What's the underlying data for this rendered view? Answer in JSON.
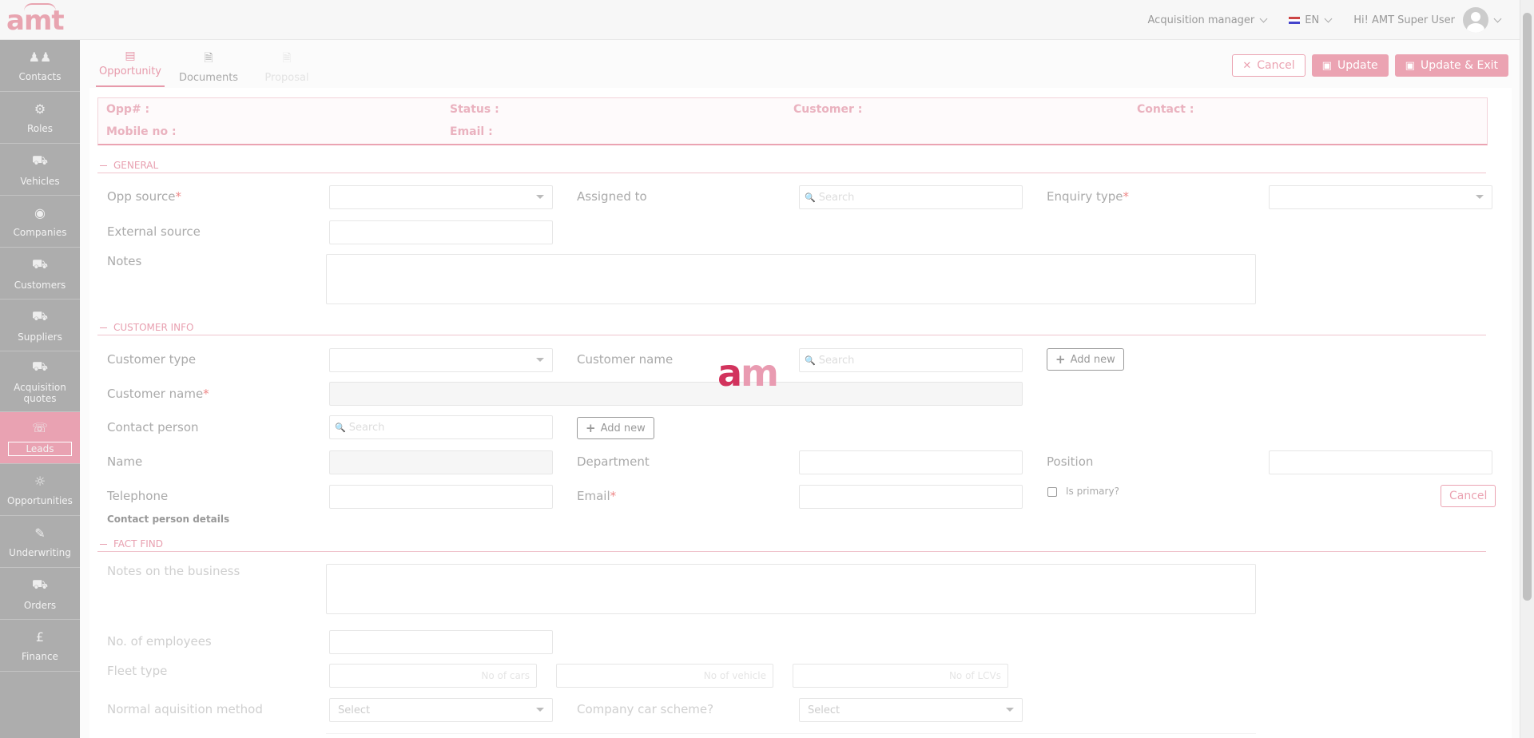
{
  "app": {
    "logo_text": "amt",
    "role_label": "Acquisition manager",
    "lang_label": "EN",
    "user_greeting": "Hi! AMT Super User"
  },
  "sidebar": {
    "items": [
      {
        "label": "Contacts",
        "icon": "contacts-icon"
      },
      {
        "label": "Roles",
        "icon": "roles-icon"
      },
      {
        "label": "Vehicles",
        "icon": "car-icon"
      },
      {
        "label": "Companies",
        "icon": "companies-icon"
      },
      {
        "label": "Customers",
        "icon": "customers-icon"
      },
      {
        "label": "Suppliers",
        "icon": "suppliers-icon"
      },
      {
        "label": "Acquisition quotes",
        "icon": "quotes-icon"
      },
      {
        "label": "Leads",
        "icon": "leads-icon",
        "active": true
      },
      {
        "label": "Opportunities",
        "icon": "bulb-icon"
      },
      {
        "label": "Underwriting",
        "icon": "underwriting-icon"
      },
      {
        "label": "Orders",
        "icon": "cart-icon"
      },
      {
        "label": "Finance",
        "icon": "pound-icon"
      }
    ]
  },
  "tabs": [
    {
      "label": "Opportunity",
      "state": "active"
    },
    {
      "label": "Documents",
      "state": "normal"
    },
    {
      "label": "Proposal",
      "state": "disabled"
    }
  ],
  "actions": {
    "cancel": "Cancel",
    "update": "Update",
    "update_exit": "Update & Exit"
  },
  "summary": {
    "opp": "Opp# :",
    "status": "Status :",
    "customer": "Customer :",
    "contact": "Contact :",
    "mobile": "Mobile no :",
    "email": "Email :"
  },
  "sections": {
    "general": "GENERAL",
    "customer_info": "CUSTOMER INFO",
    "fact_find": "FACT FIND"
  },
  "general": {
    "opp_source": "Opp source",
    "assigned_to": "Assigned to",
    "enquiry_type": "Enquiry type",
    "external_source": "External source",
    "notes": "Notes",
    "search_placeholder": "Search"
  },
  "customer_info": {
    "customer_type": "Customer type",
    "customer_name_search": "Customer name",
    "customer_name": "Customer name",
    "contact_person": "Contact person",
    "name": "Name",
    "department": "Department",
    "position": "Position",
    "telephone": "Telephone",
    "email": "Email",
    "is_primary": "Is primary?",
    "cancel": "Cancel",
    "contact_person_details": "Contact person details",
    "add_new": "Add new",
    "search_placeholder": "Search"
  },
  "fact_find": {
    "notes_business": "Notes on the business",
    "no_employees": "No. of employees",
    "fleet_type": "Fleet type",
    "no_of_cars": "No of cars",
    "no_of_vehicles": "No of vehicle",
    "no_of_lcvs": "No of LCVs",
    "normal_acq_method": "Normal aquisition method",
    "company_car_scheme": "Company car scheme?",
    "select": "Select"
  },
  "loader": {
    "a": "a",
    "m": "m"
  },
  "colors": {
    "accent": "#eba3b2",
    "sidebar": "#adadad",
    "loader_dark": "#d2335d"
  }
}
